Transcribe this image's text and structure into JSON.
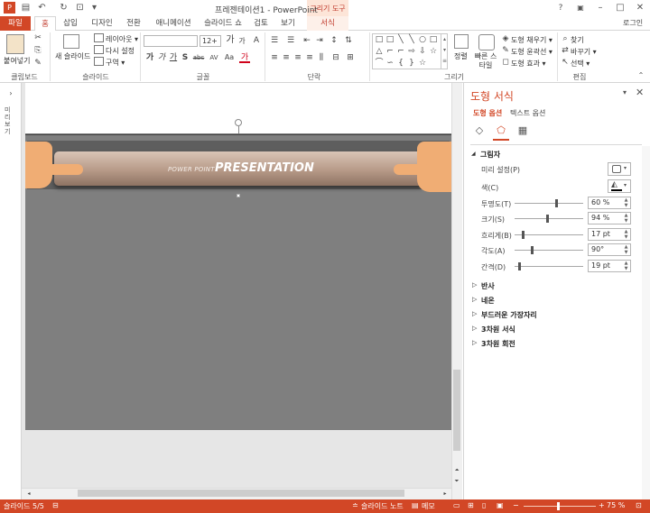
{
  "window": {
    "title": "프레젠테이션1 - PowerPoint",
    "contextual_group": "그리기 도구",
    "login": "로그인",
    "min_glyph": "–",
    "max_glyph": "□",
    "close_glyph": "✕",
    "help_glyph": "?",
    "ribbon_toggle_glyph": "▣"
  },
  "qat": {
    "save_glyph": "▤",
    "undo_glyph": "↶",
    "redo_glyph": "↻",
    "start_glyph": "⊡",
    "more_glyph": "▾"
  },
  "tabs": [
    "파일",
    "홈",
    "삽입",
    "디자인",
    "전환",
    "애니메이션",
    "슬라이드 쇼",
    "검토",
    "보기",
    "서식"
  ],
  "ribbon": {
    "clipboard": {
      "label": "클립보드",
      "paste": "붙여넣기"
    },
    "slides": {
      "label": "슬라이드",
      "new_slide": "새 슬라이드",
      "layout": "레이아웃 ▾",
      "reset": "다시 설정",
      "section": "구역 ▾"
    },
    "font": {
      "label": "글꼴",
      "font_name": "",
      "font_size": "12+",
      "grow": "가",
      "shrink": "가",
      "bold": "가",
      "italic": "가",
      "underline": "가",
      "shadow": "S",
      "strike": "abc",
      "spacing": "AV",
      "case": "Aa",
      "color": "가",
      "clear": "A"
    },
    "paragraph": {
      "label": "단락"
    },
    "drawing": {
      "label": "그리기",
      "arrange": "정렬",
      "quick_styles": "빠른 스타일",
      "fill": "도형 채우기 ▾",
      "outline": "도형 윤곽선 ▾",
      "effects": "도형 효과 ▾"
    },
    "editing": {
      "label": "편집",
      "find": "찾기",
      "replace": "바꾸기 ▾",
      "select": "선택 ▾"
    }
  },
  "left_rail": {
    "label": "미리보기"
  },
  "slide": {
    "banner_small": "POWER POINT",
    "banner_big": "PRESENTATION"
  },
  "pane": {
    "title": "도형 서식",
    "tab_shape": "도형 옵션",
    "tab_text": "텍스트 옵션",
    "shadow_section": "그림자",
    "preset_label": "미리 설정(P)",
    "color_label": "색(C)",
    "properties": [
      {
        "label": "투명도(T)",
        "value": "60 %",
        "level": 0.6
      },
      {
        "label": "크기(S)",
        "value": "94 %",
        "level": 0.47
      },
      {
        "label": "흐리게(B)",
        "value": "17 pt",
        "level": 0.12
      },
      {
        "label": "각도(A)",
        "value": "90°",
        "level": 0.25
      },
      {
        "label": "간격(D)",
        "value": "19 pt",
        "level": 0.06
      }
    ],
    "collapsed_sections": [
      "반사",
      "네온",
      "부드러운 가장자리",
      "3차원 서식",
      "3차원 회전"
    ]
  },
  "status": {
    "slide_info": "슬라이드 5/5",
    "notes": "슬라이드 노트",
    "comments": "메모",
    "zoom": "75 %",
    "zoom_level": 0.47
  },
  "colors": {
    "accent": "#d24726",
    "slide_bg": "#7f7f7f",
    "banner": "#b79a88",
    "hand": "#f0ad74"
  }
}
